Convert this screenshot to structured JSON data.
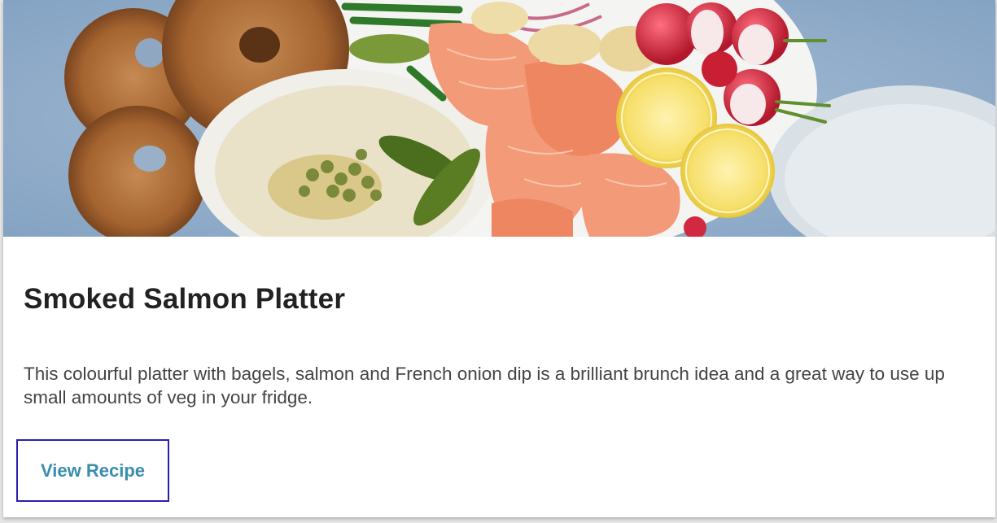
{
  "card": {
    "image_alt": "Smoked salmon platter with bagels, French onion dip, capers, gherkins, lemon, radishes and potatoes",
    "title": "Smoked Salmon Platter",
    "description": "This colourful platter with bagels, salmon and French onion dip is a brilliant brunch idea and a great way to use up small amounts of veg in your fridge.",
    "cta_label": "View Recipe"
  },
  "colors": {
    "title": "#222222",
    "text": "#444444",
    "link": "#3a8dae",
    "focus_border": "#2a1fb0",
    "background": "#ffffff"
  }
}
